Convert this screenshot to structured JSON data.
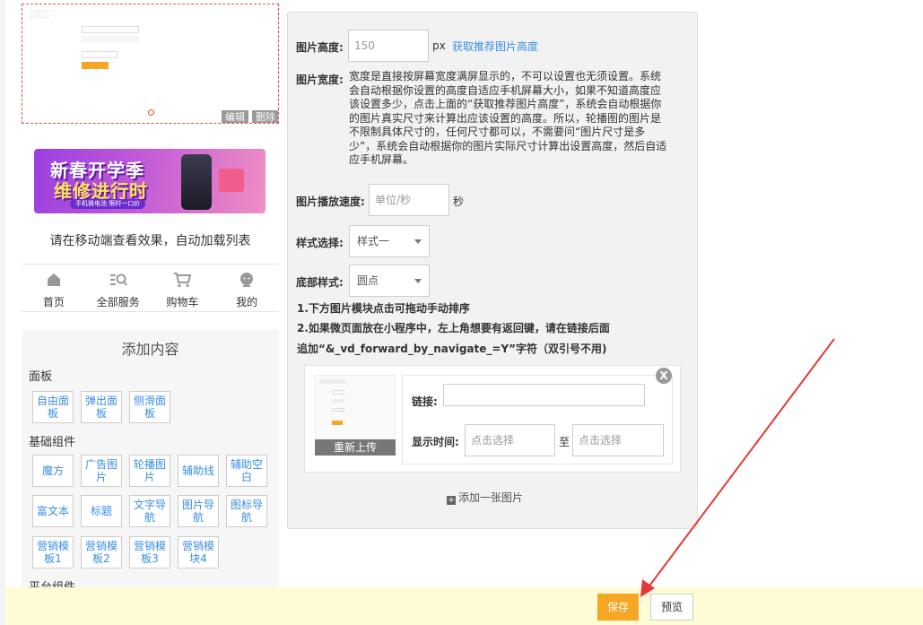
{
  "preview": {
    "thumb_tabs": [
      "",
      "",
      ""
    ],
    "edit_label": "编辑",
    "delete_label": "删除",
    "banner_line1": "新春开学季",
    "banner_line2": "维修进行时",
    "banner_tag": "手机换电池 限时一口价",
    "note": "请在移动端查看效果，自动加载列表"
  },
  "tabbar": {
    "items": [
      {
        "label": "首页",
        "icon": "home-icon"
      },
      {
        "label": "全部服务",
        "icon": "search-list-icon"
      },
      {
        "label": "购物车",
        "icon": "cart-icon"
      },
      {
        "label": "我的",
        "icon": "user-icon"
      }
    ]
  },
  "add_panel": {
    "title": "添加内容",
    "group_panel": "面板",
    "panel_buttons": [
      "自由面板",
      "弹出面板",
      "侧滑面板"
    ],
    "group_basic": "基础组件",
    "basic_buttons": [
      "魔方",
      "广告图片",
      "轮播图片",
      "辅助线",
      "辅助空白",
      "富文本",
      "标题",
      "文字导航",
      "图片导航",
      "图标导航",
      "营销模板1",
      "营销模板2",
      "营销模板3",
      "营销模块4"
    ],
    "group_platform": "平台组件"
  },
  "form": {
    "height_label": "图片高度:",
    "height_value": "150",
    "height_unit": "px",
    "height_link": "获取推荐图片高度",
    "width_label": "图片宽度:",
    "width_desc": "宽度是直接按屏幕宽度满屏显示的，不可以设置也无须设置。系统会自动根据你设置的高度自适应手机屏幕大小，如果不知道高度应该设置多少，点击上面的“获取推荐图片高度”，系统会自动根据你的图片真实尺寸来计算出应该设置的高度。所以，轮播图的图片是不限制具体尺寸的，任何尺寸都可以，不需要问“图片尺寸是多少”，系统会自动根据你的图片实际尺寸计算出设置高度，然后自适应手机屏幕。",
    "speed_label": "图片播放速度:",
    "speed_placeholder": "单位/秒",
    "speed_unit": "秒",
    "style_label": "样式选择:",
    "style_value": "样式一",
    "bottom_label": "底部样式:",
    "bottom_value": "圆点",
    "note1": "1.下方图片模块点击可拖动手动排序",
    "note2": "2.如果微页面放在小程序中，左上角想要有返回键，请在链接后面",
    "note3": "追加“&_vd_forward_by_navigate_=Y”字符（双引号不用)",
    "reupload_label": "重新上传",
    "close_label": "X",
    "link_label": "链接:",
    "link_value": "",
    "time_label": "显示时间:",
    "time_start_placeholder": "点击选择",
    "time_to": "至",
    "time_end_placeholder": "点击选择",
    "add_image_label": "添加一张图片"
  },
  "footer": {
    "save_label": "保存",
    "preview_label": "预览"
  },
  "colors": {
    "accent": "#f5a623",
    "link": "#3a8ee6",
    "annotation_arrow": "#e53935",
    "footer_bg": "#fffbd6"
  }
}
